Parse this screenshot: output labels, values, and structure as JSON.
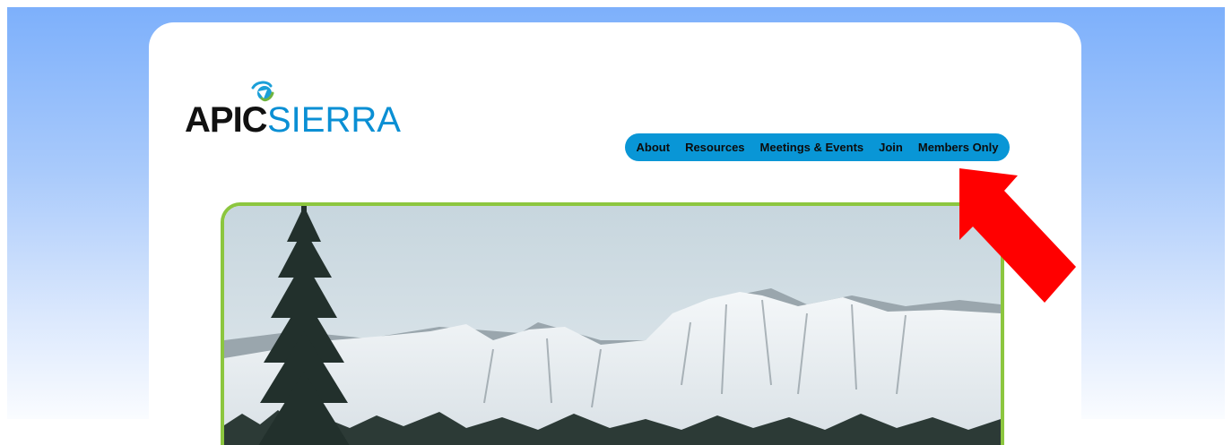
{
  "logo": {
    "brand_left": "APIC",
    "brand_right": "SIERRA",
    "brand_colors": {
      "left": "#111111",
      "right": "#0a8fd4",
      "mark_teal": "#1b9fd8",
      "mark_green": "#6fb43f"
    }
  },
  "nav": {
    "items": [
      {
        "label": "About"
      },
      {
        "label": "Resources"
      },
      {
        "label": "Meetings & Events"
      },
      {
        "label": "Join"
      },
      {
        "label": "Members Only"
      }
    ],
    "bar_color": "#0996d6"
  },
  "hero": {
    "frame_color": "#8cc63f",
    "scene": "snowy-mountains"
  },
  "annotation": {
    "arrow_color": "#ff0000",
    "arrow_icon": "red-pointer-arrow-icon"
  }
}
